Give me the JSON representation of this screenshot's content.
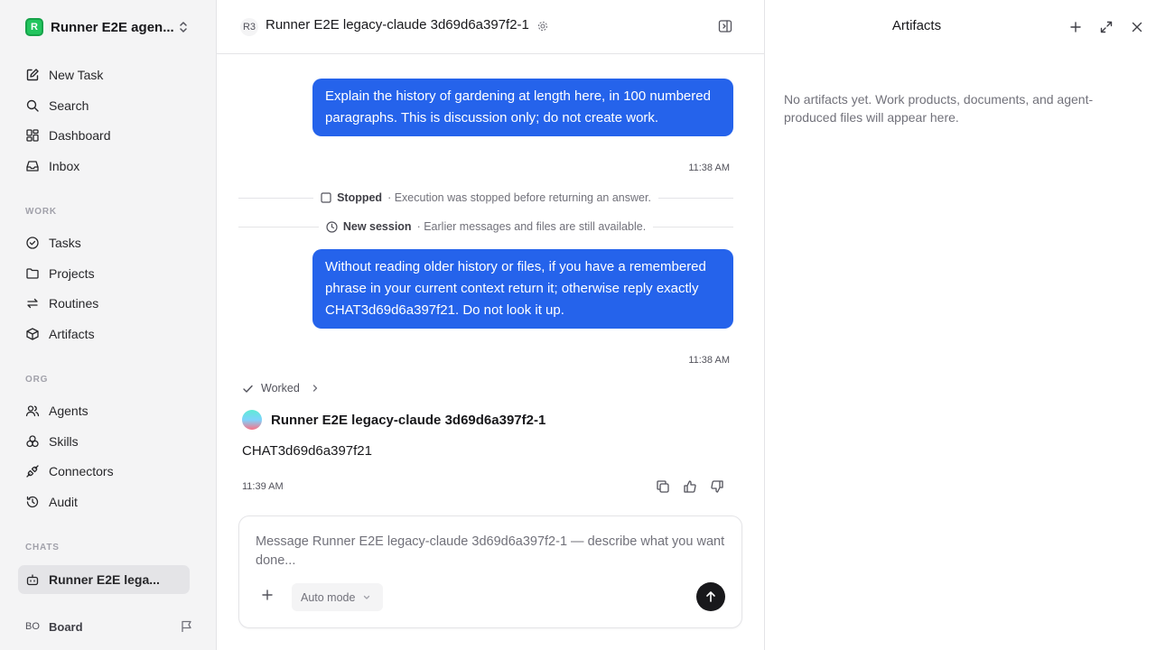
{
  "workspace": {
    "logo_letter": "R",
    "name": "Runner E2E agen..."
  },
  "nav_primary": [
    {
      "label": "New Task",
      "icon": "new-task-icon"
    },
    {
      "label": "Search",
      "icon": "search-icon"
    },
    {
      "label": "Dashboard",
      "icon": "dashboard-icon"
    },
    {
      "label": "Inbox",
      "icon": "inbox-icon"
    }
  ],
  "sections": {
    "work": "WORK",
    "org": "ORG",
    "chats": "CHATS"
  },
  "nav_work": [
    {
      "label": "Tasks",
      "icon": "tasks-icon"
    },
    {
      "label": "Projects",
      "icon": "folder-icon"
    },
    {
      "label": "Routines",
      "icon": "routines-icon"
    },
    {
      "label": "Artifacts",
      "icon": "box-icon"
    }
  ],
  "nav_org": [
    {
      "label": "Agents",
      "icon": "users-icon"
    },
    {
      "label": "Skills",
      "icon": "skills-icon"
    },
    {
      "label": "Connectors",
      "icon": "plug-icon"
    },
    {
      "label": "Audit",
      "icon": "history-icon"
    }
  ],
  "chats": [
    {
      "label": "Runner E2E lega...",
      "icon": "bot-icon",
      "active": true
    }
  ],
  "board": {
    "avatar": "BO",
    "label": "Board"
  },
  "chat_header": {
    "badge": "R3",
    "title": "Runner E2E legacy-claude 3d69d6a397f2-1"
  },
  "messages": {
    "user1": {
      "text": "Explain the history of gardening at length here, in 100 numbered paragraphs. This is discussion only; do not create work.",
      "time": "11:38 AM"
    },
    "stopped": {
      "label": "Stopped",
      "detail": "· Execution was stopped before returning an answer."
    },
    "session": {
      "label": "New session",
      "detail": "· Earlier messages and files are still available."
    },
    "user2": {
      "text": "Without reading older history or files, if you have a remembered phrase in your current context return it; otherwise reply exactly CHAT3d69d6a397f21. Do not look it up.",
      "time": "11:38 AM"
    },
    "worked_label": "Worked",
    "agent": {
      "name": "Runner E2E legacy-claude 3d69d6a397f2-1",
      "answer": "CHAT3d69d6a397f21",
      "time": "11:39 AM"
    }
  },
  "composer": {
    "placeholder": "Message Runner E2E legacy-claude 3d69d6a397f2-1 — describe what you want done...",
    "value": "",
    "mode": "Auto mode"
  },
  "artifacts_panel": {
    "title": "Artifacts",
    "empty_text": "No artifacts yet. Work products, documents, and agent-produced files will appear here."
  },
  "colors": {
    "accent": "#2563eb",
    "brand": "#22c55e",
    "send": "#18181b"
  }
}
